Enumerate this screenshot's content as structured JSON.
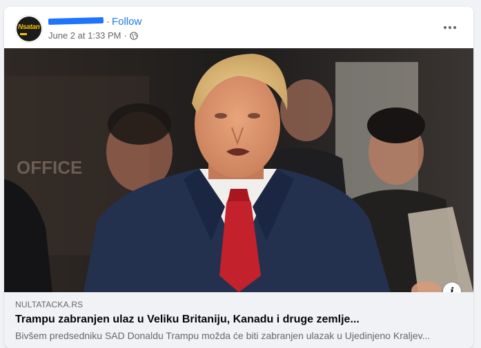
{
  "post": {
    "page_name_redacted": true,
    "separator": "·",
    "follow_label": "Follow",
    "timestamp": "June 2 at 1:33 PM",
    "time_dot": "·",
    "audience_icon": "globe-icon",
    "more_icon": "more-horizontal-icon",
    "avatar": {
      "logo_text": "Nsatan",
      "colors": {
        "background": "#1b1b1b",
        "accent": "#f2c200"
      }
    }
  },
  "photo": {
    "description_icon": "info-icon",
    "info_label": "i"
  },
  "link_preview": {
    "domain": "NULTATACKA.RS",
    "headline": "Trampu zabranjen ulaz u Veliku Britaniju, Kanadu i druge zemlje...",
    "description": "Bivšem predsedniku SAD Donaldu Trampu možda će biti zabranjen ulazak u Ujedinjeno Kraljev..."
  },
  "colors": {
    "accent": "#1877f2",
    "redaction": "#1e73ff",
    "secondary_text": "#65676b",
    "preview_background": "#f0f2f5"
  }
}
